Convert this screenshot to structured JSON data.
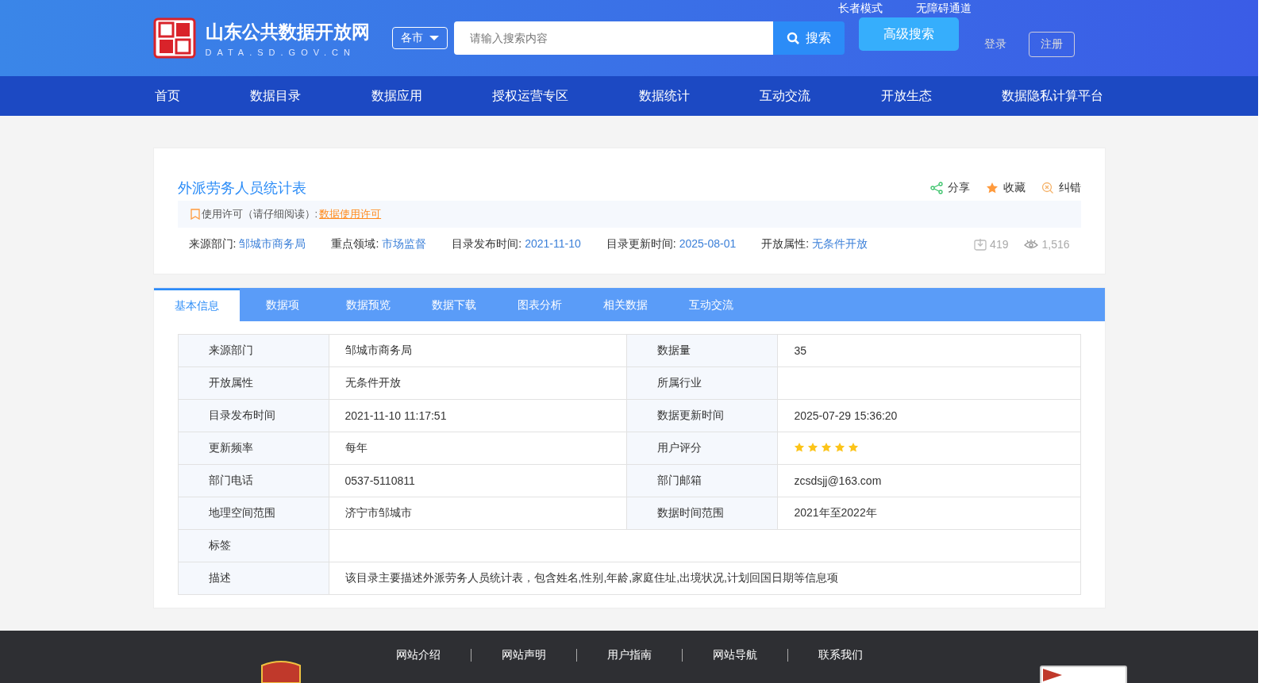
{
  "header": {
    "site_title": "山东公共数据开放网",
    "site_domain": "DATA.SD.GOV.CN",
    "region_select": "各市",
    "search": {
      "placeholder": "请输入搜索内容",
      "button": "搜索"
    },
    "advanced_search": "高级搜索",
    "top_links": [
      "长者模式",
      "无障碍通道"
    ],
    "login": "登录",
    "register": "注册"
  },
  "nav": [
    "首页",
    "数据目录",
    "数据应用",
    "授权运营专区",
    "数据统计",
    "互动交流",
    "开放生态",
    "数据隐私计算平台"
  ],
  "dataset": {
    "title": "外派劳务人员统计表",
    "actions": [
      {
        "kind": "share",
        "label": "分享"
      },
      {
        "kind": "favorite",
        "label": "收藏"
      },
      {
        "kind": "report",
        "label": "纠错"
      }
    ],
    "license": {
      "label": "使用许可（请仔细阅读）:",
      "link": "数据使用许可"
    },
    "meta": [
      {
        "label": "来源部门:",
        "value": "邹城市商务局"
      },
      {
        "label": "重点领域:",
        "value": "市场监督"
      },
      {
        "label": "目录发布时间:",
        "value": "2021-11-10"
      },
      {
        "label": "目录更新时间:",
        "value": "2025-08-01"
      },
      {
        "label": "开放属性:",
        "value": "无条件开放"
      }
    ],
    "downloads": "419",
    "views": "1,516"
  },
  "tabs": [
    {
      "label": "基本信息",
      "selected": true
    },
    {
      "label": "数据项",
      "selected": false
    },
    {
      "label": "数据预览",
      "selected": false
    },
    {
      "label": "数据下载",
      "selected": false
    },
    {
      "label": "图表分析",
      "selected": false
    },
    {
      "label": "相关数据",
      "selected": false
    },
    {
      "label": "互动交流",
      "selected": false
    }
  ],
  "info_table": [
    [
      {
        "label": "来源部门",
        "value": "邹城市商务局"
      },
      {
        "label": "数据量",
        "value": "35"
      }
    ],
    [
      {
        "label": "开放属性",
        "value": "无条件开放"
      },
      {
        "label": "所属行业"
      }
    ],
    [
      {
        "label": "目录发布时间",
        "value": "2021-11-10 11:17:51"
      },
      {
        "label": "数据更新时间",
        "value": "2025-07-29 15:36:20"
      }
    ],
    [
      {
        "label": "更新频率",
        "value": "每年"
      },
      {
        "label": "用户评分",
        "stars": 5
      }
    ],
    [
      {
        "label": "部门电话",
        "value": "0537-5110811"
      },
      {
        "label": "部门邮箱",
        "value": "zcsdsjj@163.com"
      }
    ],
    [
      {
        "label": "地理空间范围",
        "value": "济宁市邹城市"
      },
      {
        "label": "数据时间范围",
        "value": "2021年至2022年"
      }
    ],
    [
      {
        "label": "标签"
      }
    ],
    [
      {
        "label": "描述",
        "value": "该目录主要描述外派劳务人员统计表，包含姓名,性别,年龄,家庭住址,出境状况,计划回国日期等信息项"
      }
    ]
  ],
  "footer": {
    "links": [
      "网站介绍",
      "网站声明",
      "用户指南",
      "网站导航",
      "联系我们"
    ]
  }
}
